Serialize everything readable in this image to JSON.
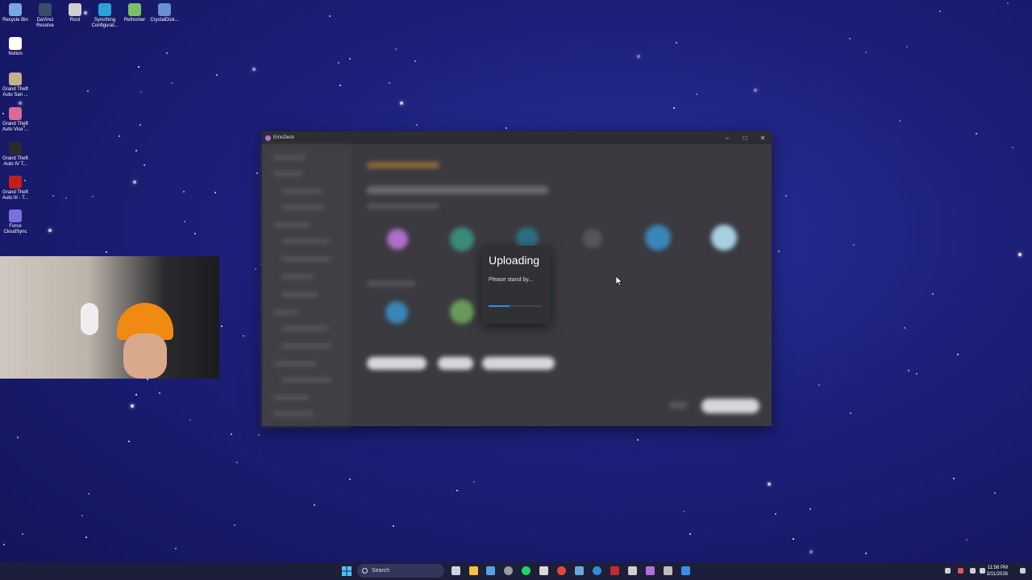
{
  "desktop": {
    "icons": [
      {
        "label": "Recycle Bin",
        "icon": "recycle-bin-icon",
        "color": "#7aa7e0"
      },
      {
        "label": "DaVinci Resolve",
        "icon": "davinci-resolve-icon",
        "color": "#3b4d6e"
      },
      {
        "label": "Root",
        "icon": "root-icon",
        "color": "#d0d0d0"
      },
      {
        "label": "Syncthing Configurat...",
        "icon": "syncthing-icon",
        "color": "#2aa3d8"
      },
      {
        "label": "Refresher",
        "icon": "refresher-icon",
        "color": "#7ac06a"
      },
      {
        "label": "CrystalDisk...",
        "icon": "crystaldisk-icon",
        "color": "#6a8fd0"
      },
      {
        "label": "Notion",
        "icon": "notion-icon",
        "color": "#ffffff"
      },
      {
        "label": "Grand Theft Auto San ...",
        "icon": "gta-sa-icon",
        "color": "#c4b08a"
      },
      {
        "label": "Grand Theft Auto Vice ...",
        "icon": "gta-vc-icon",
        "color": "#d76a9a"
      },
      {
        "label": "Grand Theft Auto IV T...",
        "icon": "gta-iv-icon",
        "color": "#2b2b2b"
      },
      {
        "label": "Grand Theft Auto III - T...",
        "icon": "gta-iii-icon",
        "color": "#c41d1d"
      },
      {
        "label": "Force CloudSync",
        "icon": "force-cloudsync-icon",
        "color": "#7a6fe0"
      }
    ]
  },
  "window": {
    "title": "EmuDeck",
    "controls": {
      "minimize": "–",
      "maximize": "□",
      "close": "✕"
    }
  },
  "dialog": {
    "title": "Uploading",
    "message": "Please stand by...",
    "progress": 0.4
  },
  "taskbar": {
    "search_label": "Search",
    "time": "11:56 PM",
    "date": "3/11/2026"
  }
}
